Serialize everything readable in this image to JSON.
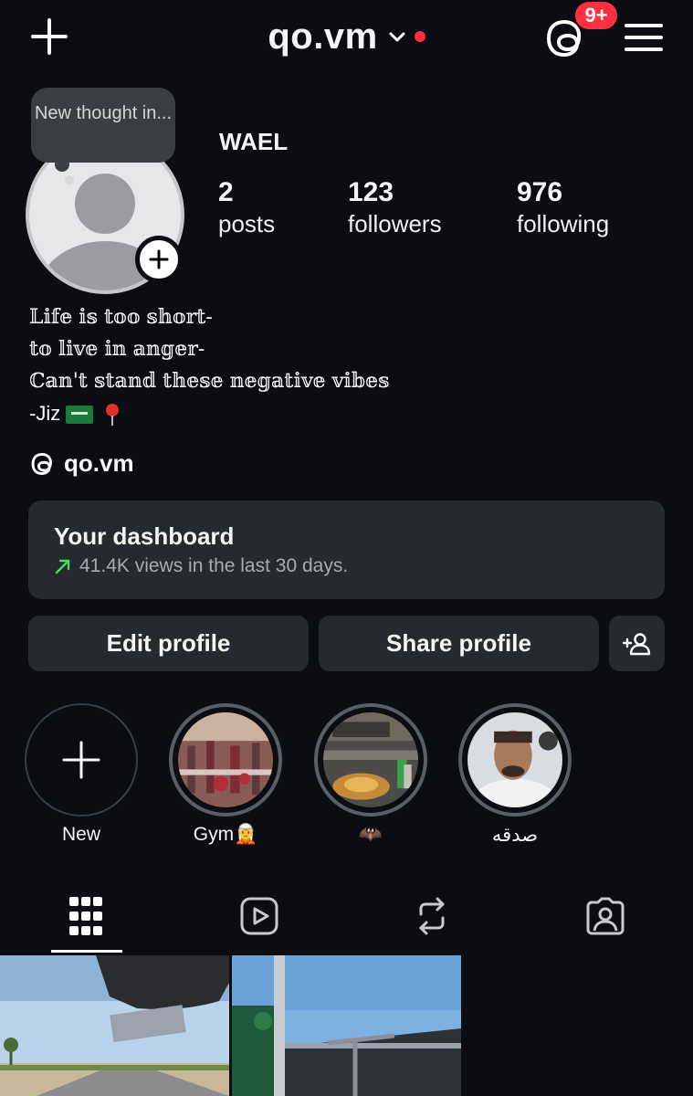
{
  "header": {
    "username": "qo.vm",
    "notification_badge": "9+",
    "icons": [
      "plus-icon",
      "chevron-down-icon",
      "threads-icon",
      "hamburger-menu-icon"
    ]
  },
  "profile": {
    "note_bubble": "New thought in...",
    "display_name": "WAEL",
    "stats": [
      {
        "value": "2",
        "label": "posts"
      },
      {
        "value": "123",
        "label": "followers"
      },
      {
        "value": "976",
        "label": "following"
      }
    ],
    "bio_lines": [
      "𝕃𝕚𝕗𝕖 𝕚𝕤 𝕥𝕠𝕠 𝕤𝕙𝕠𝕣𝕥-",
      "𝕥𝕠 𝕝𝕚𝕧𝕖 𝕚𝕟 𝕒𝕟𝕘𝕖𝕣-",
      "ℂ𝕒𝕟'𝕥 𝕤𝕥𝕒𝕟𝕕 𝕥𝕙𝕖𝕤𝕖 𝕟𝕖𝕘𝕒𝕥𝕚𝕧𝕖 𝕧𝕚𝕓𝕖𝕤",
      "-Jiz"
    ],
    "threads_handle": "qo.vm"
  },
  "dashboard": {
    "title": "Your dashboard",
    "subtitle": "41.4K views in the last 30 days."
  },
  "actions": {
    "edit_label": "Edit profile",
    "share_label": "Share profile"
  },
  "highlights": [
    {
      "label": "New"
    },
    {
      "label": "Gym🧝"
    },
    {
      "label": "🦇"
    },
    {
      "label": "صدقه"
    }
  ],
  "tabs": [
    "grid-icon",
    "reels-icon",
    "reposts-icon",
    "tagged-icon"
  ],
  "colors": {
    "background": "#0b0d12",
    "card": "#262930",
    "badge_red": "#ff3040",
    "trend_green": "#4cd964"
  }
}
